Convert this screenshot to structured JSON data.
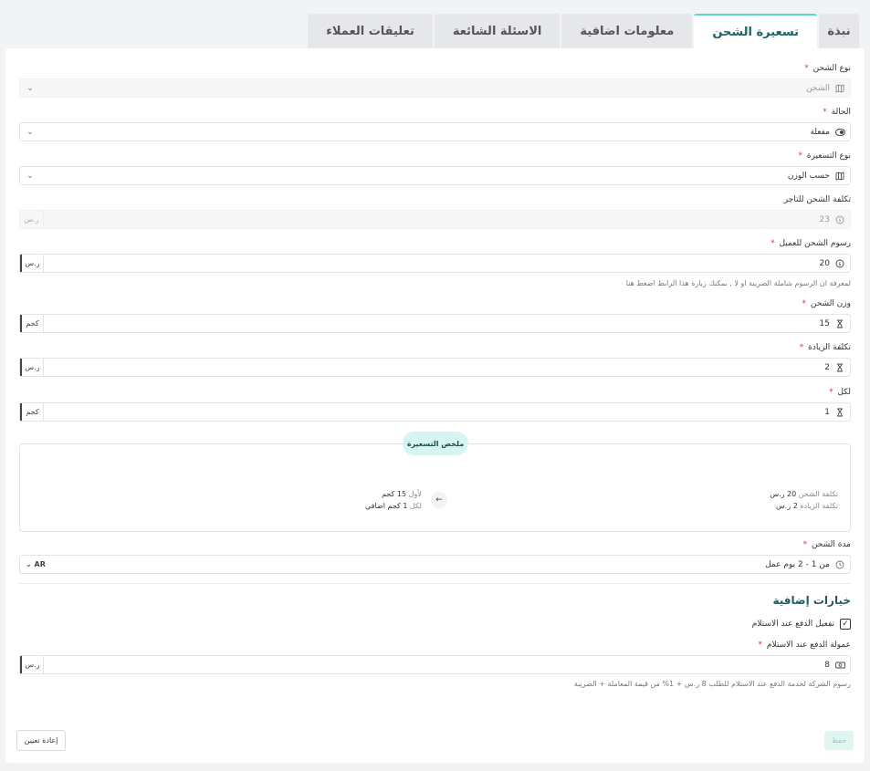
{
  "tabs": [
    {
      "label": "نبذة"
    },
    {
      "label": "تسعيرة الشحن"
    },
    {
      "label": "معلومات اضافية"
    },
    {
      "label": "الاسئلة الشائعة"
    },
    {
      "label": "تعليقات العملاء"
    }
  ],
  "fields": {
    "shipping_type": {
      "label": "نوع الشحن",
      "value": "الشحن"
    },
    "status": {
      "label": "الحالة",
      "value": "مفعلة"
    },
    "pricing_type": {
      "label": "نوع التسعيرة",
      "value": "حسب الوزن"
    },
    "merchant_cost": {
      "label": "تكلفة الشحن للتاجر",
      "value": "23",
      "suffix": "ر.س"
    },
    "customer_fee": {
      "label": "رسوم الشحن للعميل",
      "value": "20",
      "suffix": "ر.س"
    },
    "weight": {
      "label": "وزن الشحن",
      "value": "15",
      "suffix": "كجم"
    },
    "extra_cost": {
      "label": "تكلفة الزيادة",
      "value": "2",
      "suffix": "ر.س"
    },
    "per": {
      "label": "لكل",
      "value": "1",
      "suffix": "كجم"
    },
    "duration": {
      "label": "مدة الشحن",
      "value": "من 1 - 2  يوم عمل",
      "lang": "AR"
    },
    "cod_commission": {
      "label": "عمولة الدفع عند الاستلام",
      "value": "8",
      "suffix": "ر.س"
    }
  },
  "tax_hint": "لمعرفة ان الرسوم شاملة الضريبة او لا , بمكنك زيارة هذا الرابط اضغط هنا",
  "summary": {
    "badge": "ملخص التسعيرة",
    "right_line1_label": "تكلفة الشحن",
    "right_line1_value": "20 ر.س",
    "right_line2_label": "تكلفة الزيادة",
    "right_line2_value": "2 ر.س",
    "left_line1_label": "لأول",
    "left_line1_value": "15 كجم",
    "left_line2_label": "لكل",
    "left_line2_value": "1 كجم اضافي"
  },
  "extra_section_title": "خيارات إضافية",
  "cod_checkbox_label": "تفعيل الدفع عند الاستلام",
  "cod_hint": "رسوم الشركة لخدمة الدفع عند الاستلام للطلب 8 ر.س + 1% من قيمة المعاملة + الضريبة",
  "buttons": {
    "save": "حفظ",
    "reset": "إعادة تعيين"
  },
  "required_mark": "*",
  "colors": {
    "accent": "#5dd9cc",
    "title": "#1e5b66",
    "required": "#e03434"
  }
}
